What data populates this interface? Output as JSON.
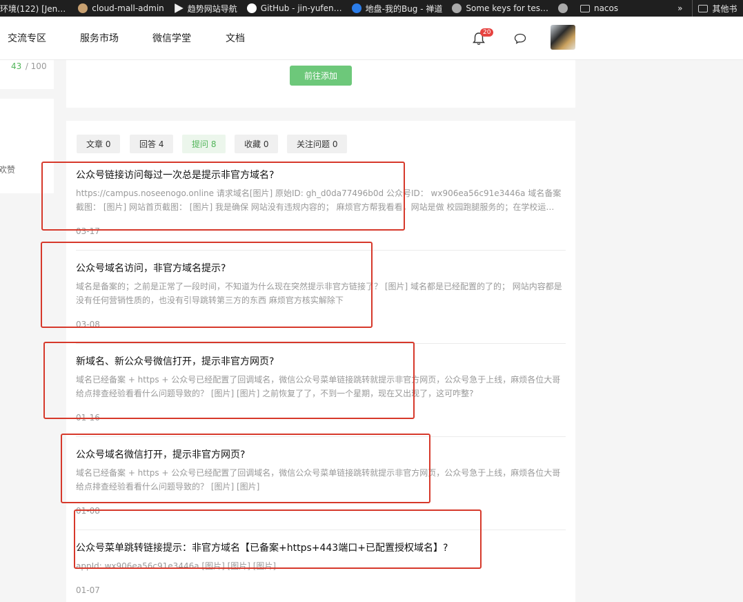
{
  "bookmarks": [
    {
      "label": "环境(122) [Jen…",
      "icon": "jenkins-icon",
      "color": "#d44"
    },
    {
      "label": "cloud-mall-admin",
      "icon": "avatar-icon",
      "color": "#c8a070"
    },
    {
      "label": "趋势网站导航",
      "icon": "play-icon",
      "color": "#eeeeee"
    },
    {
      "label": "GitHub - jin-yufen…",
      "icon": "github-icon",
      "color": "#ffffff"
    },
    {
      "label": "地盘-我的Bug - 禅道",
      "icon": "zentao-icon",
      "color": "#2b7de9"
    },
    {
      "label": "Some keys for tes…",
      "icon": "globe-icon",
      "color": "#aaaaaa"
    },
    {
      "label": "",
      "icon": "globe-icon",
      "color": "#aaaaaa"
    },
    {
      "label": "nacos",
      "icon": "folder-icon",
      "color": "#cccccc"
    },
    {
      "label": "»",
      "icon": "",
      "color": ""
    },
    {
      "label": "其他书",
      "icon": "folder-icon",
      "color": "#cccccc"
    }
  ],
  "nav": {
    "items": [
      "交流专区",
      "服务市场",
      "微信学堂",
      "文档"
    ],
    "notif_count": "20"
  },
  "left": {
    "progress_current": "43",
    "progress_total": " / 100",
    "fragment_text": "欢赞"
  },
  "add_button": "前往添加",
  "tabs": [
    {
      "label": "文章 0",
      "active": false
    },
    {
      "label": "回答 4",
      "active": false
    },
    {
      "label": "提问 8",
      "active": true
    },
    {
      "label": "收藏 0",
      "active": false
    },
    {
      "label": "关注问题 0",
      "active": false
    }
  ],
  "questions": [
    {
      "title": "公众号链接访问每过一次总是提示非官方域名?",
      "desc": "https://campus.noseenogo.online 请求域名[图片] 原始ID: gh_d0da77496b0d 公众号ID： wx906ea56c91e3446a 域名备案截图： [图片] 网站首页截图： [图片] 我是确保 网站没有违规内容的； 麻烦官方帮我看看，网站是做 校园跑腿服务的；在学校运…",
      "date": "03-17"
    },
    {
      "title": "公众号域名访问，非官方域名提示?",
      "desc": "域名是备案的；之前是正常了一段时间，不知道为什么现在突然提示非官方链接了？ [图片] 域名都是已经配置的了的； 网站内容都是没有任何营销性质的，也没有引导跳转第三方的东西 麻烦官方核实解除下",
      "date": "03-08"
    },
    {
      "title": "新域名、新公众号微信打开，提示非官方网页?",
      "desc": "域名已经备案 + https + 公众号已经配置了回调域名，微信公众号菜单链接跳转就提示非官方网页，公众号急于上线，麻烦各位大哥给点排查经验看看什么问题导致的？ [图片] [图片] 之前恢复了了，不到一个星期，现在又出现了，这可咋整?",
      "date": "01-16"
    },
    {
      "title": "公众号域名微信打开，提示非官方网页?",
      "desc": "域名已经备案 + https + 公众号已经配置了回调域名，微信公众号菜单链接跳转就提示非官方网页，公众号急于上线，麻烦各位大哥给点排查经验看看什么问题导致的？ [图片] [图片]",
      "date": "01-08"
    },
    {
      "title": "公众号菜单跳转链接提示：非官方域名【已备案+https+443端口+已配置授权域名】?",
      "desc": "appId: wx906ea56c91e3446a [图片] [图片] [图片]",
      "date": "01-07"
    }
  ]
}
